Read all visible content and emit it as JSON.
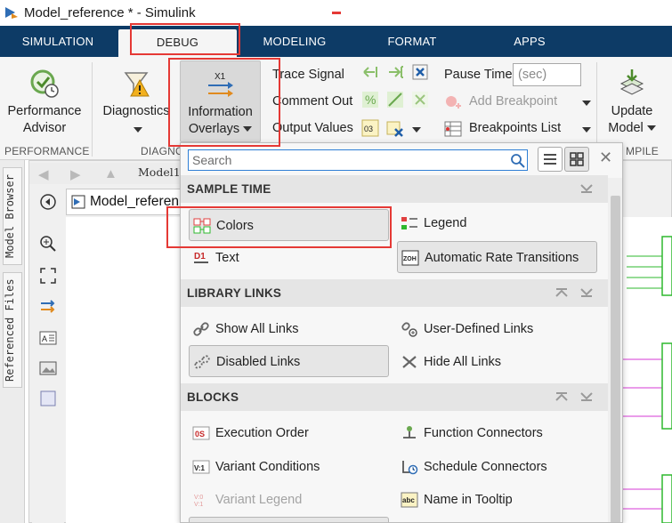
{
  "window": {
    "title": "Model_reference * - Simulink"
  },
  "tabs": [
    "SIMULATION",
    "DEBUG",
    "MODELING",
    "FORMAT",
    "APPS"
  ],
  "ribbon": {
    "performance_advisor": [
      "Performance",
      "Advisor"
    ],
    "diagnostics": "Diagnostics",
    "information_overlays": [
      "Information",
      "Overlays"
    ],
    "overlay_icon_text": "X1",
    "trace_signal": "Trace Signal",
    "comment_out": "Comment Out",
    "output_values": "Output Values",
    "pause_time_label": "Pause Time",
    "pause_time_placeholder": "(sec)",
    "add_breakpoint": "Add Breakpoint",
    "breakpoints_list": "Breakpoints List",
    "update_model": [
      "Update",
      "Model"
    ],
    "section_performance": "PERFORMANCE",
    "section_diagnostics": "DIAGNO",
    "section_compile": "MPILE"
  },
  "side_tabs": [
    "Model Browser",
    "Referenced Files"
  ],
  "canvas": {
    "breadcrumb": "Model1",
    "model_label": "Model_referen"
  },
  "overlay": {
    "search_placeholder": "Search",
    "sections": {
      "sample_time": "SAMPLE TIME",
      "library_links": "LIBRARY LINKS",
      "blocks": "BLOCKS"
    },
    "items": {
      "colors": "Colors",
      "legend": "Legend",
      "text": "Text",
      "automatic_rate_transitions": "Automatic Rate Transitions",
      "show_all_links": "Show All Links",
      "user_defined_links": "User-Defined Links",
      "disabled_links": "Disabled Links",
      "hide_all_links": "Hide All Links",
      "execution_order": "Execution Order",
      "function_connectors": "Function Connectors",
      "variant_conditions": "Variant Conditions",
      "schedule_connectors": "Schedule Connectors",
      "variant_legend": "Variant Legend",
      "name_in_tooltip": "Name in Tooltip"
    },
    "icon_text": {
      "text": "D1",
      "auto_rate": "ZOH",
      "exec_order": "0S",
      "variant_cond": "V:1",
      "variant_legend": "V:0 V:1",
      "name_tooltip": "abc",
      "output_values": "03"
    }
  },
  "colors": {
    "tab_bar": "#0d3b66",
    "highlight": "#e53935",
    "search_focus": "#2f7fd6",
    "signal_green": "#2eb82e",
    "signal_magenta": "#d63ad6"
  }
}
